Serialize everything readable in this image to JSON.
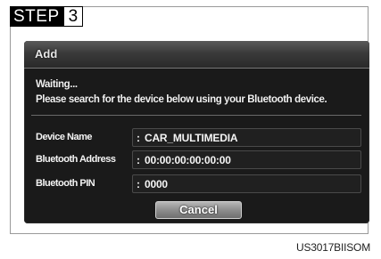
{
  "step": {
    "label": "STEP",
    "number": "3"
  },
  "dialog": {
    "title": "Add",
    "message_line1": "Waiting...",
    "message_line2": "Please search for the device below using your Bluetooth device.",
    "fields": [
      {
        "label": "Device Name",
        "value": "CAR_MULTIMEDIA"
      },
      {
        "label": "Bluetooth Address",
        "value": "00:00:00:00:00:00"
      },
      {
        "label": "Bluetooth PIN",
        "value": "0000"
      }
    ],
    "cancel_label": "Cancel"
  },
  "image_code": "US3017BIISOM"
}
